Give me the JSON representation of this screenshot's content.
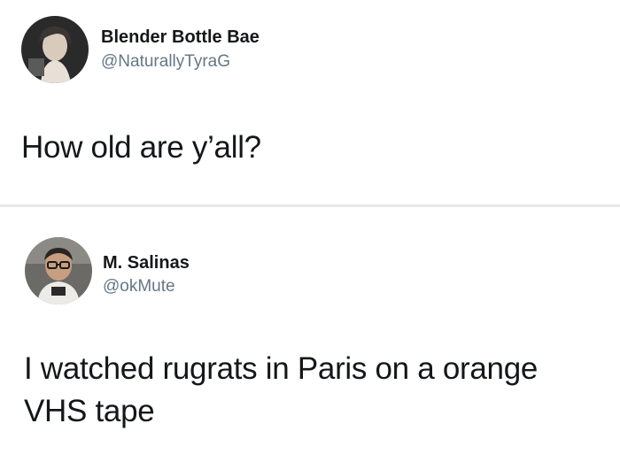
{
  "tweets": [
    {
      "display_name": "Blender Bottle Bae",
      "handle": "@NaturallyTyraG",
      "text": "How old are y’all?",
      "avatar_icon": "user-avatar-photo"
    },
    {
      "display_name": "M. Salinas",
      "handle": "@okMute",
      "text": "I watched rugrats in Paris on a orange VHS tape",
      "avatar_icon": "user-avatar-photo"
    }
  ],
  "colors": {
    "background": "#ffffff",
    "divider": "#e6e6e6",
    "primary_text": "#14171a",
    "secondary_text": "#657786"
  }
}
